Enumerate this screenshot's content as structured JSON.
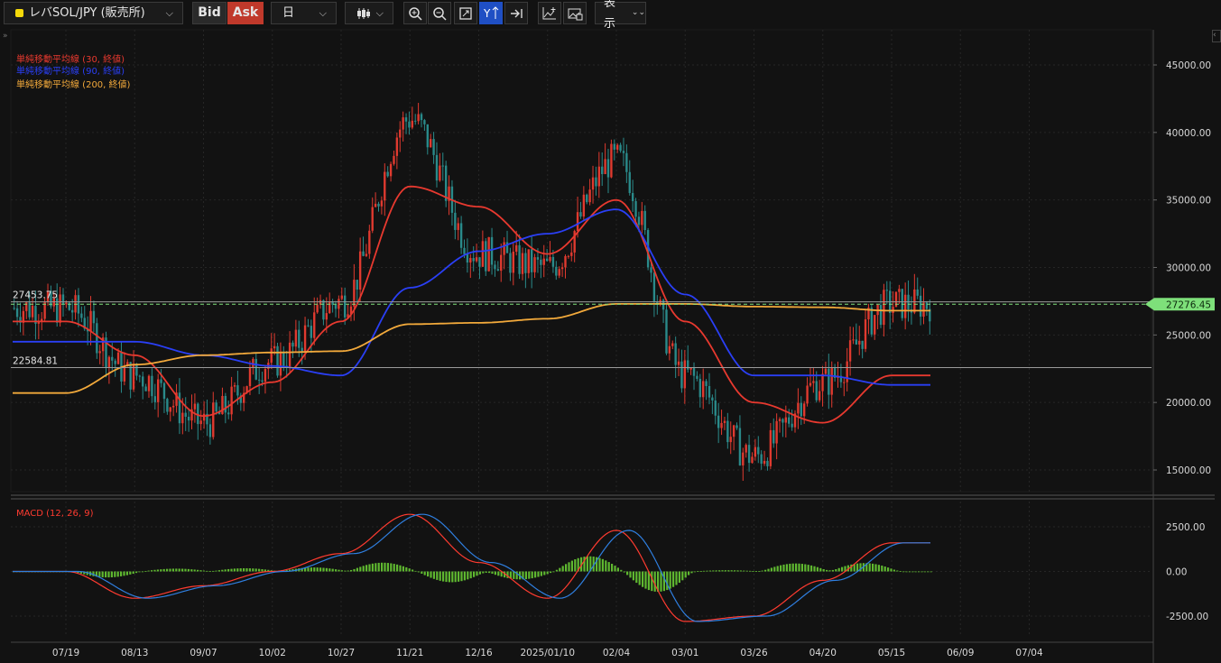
{
  "toolbar": {
    "symbol": "レバSOL/JPY (販売所)",
    "bid_label": "Bid",
    "ask_label": "Ask",
    "period": "日",
    "display_label": "表示"
  },
  "indicators": {
    "ma30": "単純移動平均線 (30, 終値)",
    "ma90": "単純移動平均線 (90, 終値)",
    "ma200": "単純移動平均線 (200, 終値)",
    "macd": "MACD (12, 26, 9)"
  },
  "price_axis": [
    "45000.00",
    "40000.00",
    "35000.00",
    "30000.00",
    "25000.00",
    "20000.00",
    "15000.00"
  ],
  "macd_axis": [
    "2500.00",
    "0.00",
    "-2500.00"
  ],
  "date_axis": [
    "07/19",
    "08/13",
    "09/07",
    "10/02",
    "10/27",
    "11/21",
    "12/16",
    "2025/01/10",
    "02/04",
    "03/01",
    "03/26",
    "04/20",
    "05/15",
    "06/09",
    "07/04"
  ],
  "level_lines": [
    "27453.75",
    "22584.81"
  ],
  "current_price": "27276.45",
  "colors": {
    "background": "#121212",
    "candle_up": "#e03a2f",
    "candle_down": "#2a8a8a",
    "ma30": "#e8392f",
    "ma90": "#2a3ff5",
    "ma200": "#f2a93b",
    "macd_line": "#ff3b30",
    "signal_line": "#2f7fe0",
    "histogram": "#5fb830",
    "price_tag": "#7ee07a",
    "ask_button": "#c0392b",
    "active_tool": "#1f4fc4"
  },
  "chart_data": {
    "type": "candlestick",
    "x": [
      "07/19",
      "08/13",
      "09/07",
      "10/02",
      "10/27",
      "11/21",
      "12/16",
      "2025/01/10",
      "02/04",
      "03/01",
      "03/26",
      "04/20",
      "05/15"
    ],
    "series": [
      {
        "name": "単純移動平均線 (30, 終値)",
        "values": [
          26000,
          23500,
          19000,
          21500,
          26000,
          36000,
          34500,
          31000,
          35000,
          26000,
          20000,
          18500,
          22000
        ]
      },
      {
        "name": "単純移動平均線 (90, 終値)",
        "values": [
          24500,
          24500,
          23500,
          22700,
          22000,
          28500,
          31200,
          32500,
          34300,
          28000,
          22000,
          22000,
          21300
        ]
      },
      {
        "name": "単純移動平均線 (200, 終値)",
        "values": [
          20700,
          22800,
          23500,
          23700,
          23800,
          25800,
          25900,
          26200,
          27300,
          27300,
          27100,
          27050,
          26800
        ]
      },
      {
        "name": "MACD (12, 26, 9)",
        "values": [
          0,
          -1500,
          -800,
          0,
          1000,
          3200,
          500,
          -1500,
          2300,
          -2800,
          -2500,
          -500,
          1600
        ]
      }
    ],
    "ylim": [
      14000,
      47000
    ],
    "macd_ylim": [
      -3500,
      3800
    ]
  }
}
